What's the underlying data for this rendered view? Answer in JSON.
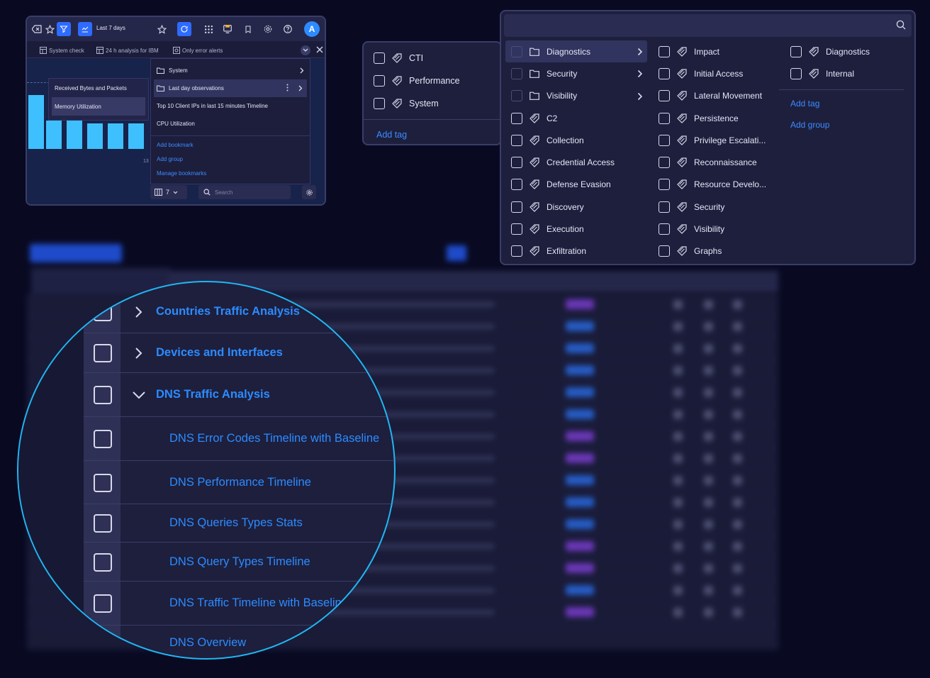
{
  "toolbar": {
    "time_range": "Last 7 days",
    "avatar_initial": "A"
  },
  "subbar": {
    "items": [
      "System check",
      "24 h analysis for IBM",
      "Only error alerts"
    ]
  },
  "chart_submenu": {
    "items": [
      "Received Bytes and Packets",
      "Memory Utilization"
    ]
  },
  "bookmark_menu": {
    "items": [
      "System",
      "Last day observations",
      "Top 10 Client IPs in last 15 minutes Timeline",
      "CPU Utilization"
    ],
    "links": [
      "Add bookmark",
      "Add group",
      "Manage bookmarks"
    ],
    "tick_label": "13"
  },
  "footer": {
    "columns_count": "7",
    "search_placeholder": "Search"
  },
  "tag_panel": {
    "options": [
      "CTI",
      "Performance",
      "System"
    ],
    "add_tag": "Add tag"
  },
  "category_panel": {
    "col1": [
      {
        "label": "Diagnostics",
        "kind": "folder",
        "arrow": true
      },
      {
        "label": "Security",
        "kind": "folder",
        "arrow": true
      },
      {
        "label": "Visibility",
        "kind": "folder",
        "arrow": true
      },
      {
        "label": "C2",
        "kind": "tag"
      },
      {
        "label": "Collection",
        "kind": "tag"
      },
      {
        "label": "Credential Access",
        "kind": "tag"
      },
      {
        "label": "Defense Evasion",
        "kind": "tag"
      },
      {
        "label": "Discovery",
        "kind": "tag"
      },
      {
        "label": "Execution",
        "kind": "tag"
      },
      {
        "label": "Exfiltration",
        "kind": "tag"
      }
    ],
    "col2": [
      "Impact",
      "Initial Access",
      "Lateral Movement",
      "Persistence",
      "Privilege Escalati...",
      "Reconnaissance",
      "Resource Develo...",
      "Security",
      "Visibility",
      "Graphs"
    ],
    "col3": [
      "Diagnostics",
      "Internal"
    ],
    "links": [
      "Add tag",
      "Add group"
    ]
  },
  "magnifier": {
    "groups": [
      {
        "label": "Countries Traffic Analysis",
        "expanded": false
      },
      {
        "label": "Devices and Interfaces",
        "expanded": false
      },
      {
        "label": "DNS Traffic Analysis",
        "expanded": true
      }
    ],
    "children": [
      "DNS Error Codes Timeline with Baseline",
      "DNS Performance Timeline",
      "DNS Queries Types Stats",
      "DNS Query Types Timeline",
      "DNS Traffic Timeline with Baseline",
      "DNS Overview"
    ]
  },
  "colors": {
    "accent": "#2e6bff",
    "link": "#3d8bff",
    "magnifier_ring": "#21b6f3",
    "background": "#090a22"
  }
}
